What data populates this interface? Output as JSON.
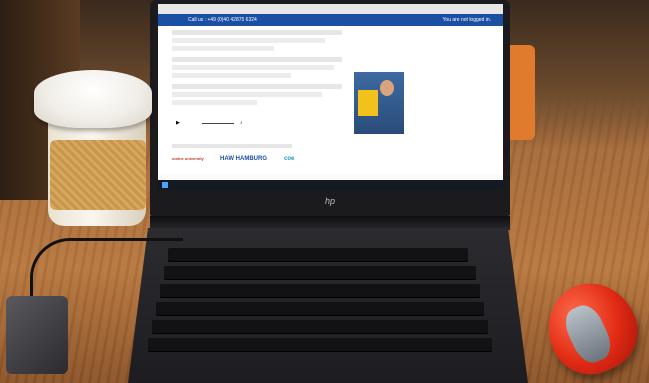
{
  "screen": {
    "site_bar": {
      "call_text": "Call us : +49 (0)40 42875 6324",
      "login_text": "You are not logged in."
    },
    "logos": {
      "left": "online university",
      "haw": "HAW HAMBURG",
      "coe": "coe"
    }
  },
  "laptop_brand": "hp",
  "colors": {
    "site_bar": "#1b4fa3",
    "cup_sleeve": "#c9964d",
    "mouse": "#e02a14"
  }
}
